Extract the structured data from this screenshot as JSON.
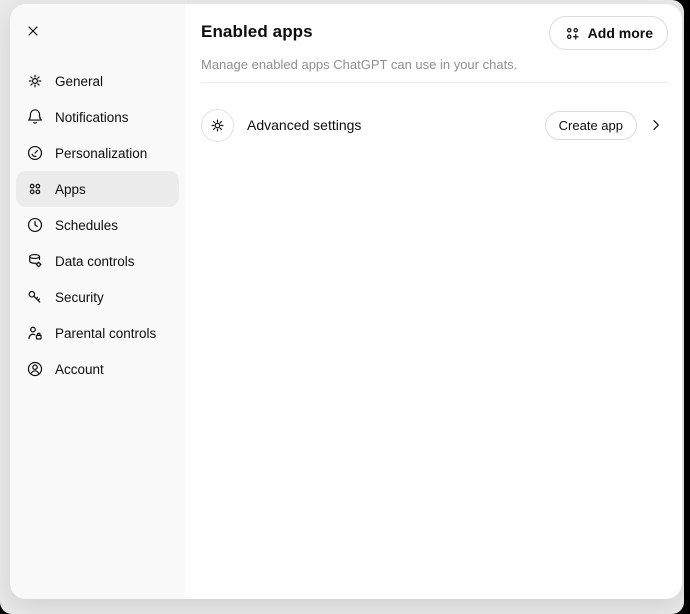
{
  "sidebar": {
    "items": [
      {
        "label": "General",
        "icon": "gear",
        "selected": false
      },
      {
        "label": "Notifications",
        "icon": "bell",
        "selected": false
      },
      {
        "label": "Personalization",
        "icon": "dial",
        "selected": false
      },
      {
        "label": "Apps",
        "icon": "apps-grid",
        "selected": true
      },
      {
        "label": "Schedules",
        "icon": "clock",
        "selected": false
      },
      {
        "label": "Data controls",
        "icon": "database-gear",
        "selected": false
      },
      {
        "label": "Security",
        "icon": "key",
        "selected": false
      },
      {
        "label": "Parental controls",
        "icon": "person-lock",
        "selected": false
      },
      {
        "label": "Account",
        "icon": "person-circle",
        "selected": false
      }
    ]
  },
  "main": {
    "title": "Enabled apps",
    "subtitle": "Manage enabled apps ChatGPT can use in your chats.",
    "add_more_button": "Add more",
    "advanced_row": {
      "label": "Advanced settings",
      "create_app_button": "Create app"
    }
  },
  "colors": {
    "page_bg": "#e9e9e9",
    "dialog_bg": "#ffffff",
    "sidebar_bg": "#f9f9f9",
    "selected_item_bg": "#ececec",
    "text_primary": "#0d0d0d",
    "text_secondary": "#8f8f8f",
    "border_light": "#e3e3e3",
    "button_border": "#dcdcdc"
  }
}
